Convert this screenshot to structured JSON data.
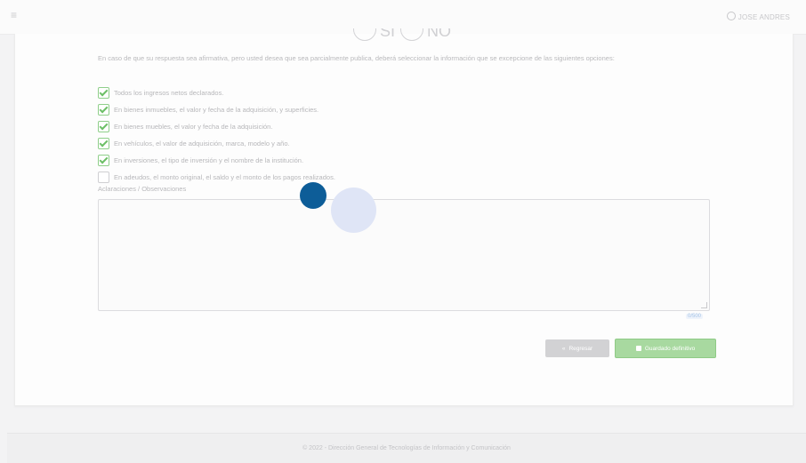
{
  "topbar": {
    "menu_icon": "hamburger-menu-icon",
    "user_icon": "user-circle-icon",
    "user_name": "JOSE ANDRES"
  },
  "question": {
    "yes_label": "SI",
    "no_label": "NO"
  },
  "intro_text": "En caso de que su respuesta sea afirmativa, pero usted desea que sea parcialmente publica, deberá seleccionar la información que se excepcione de las siguientes opciones:",
  "options": [
    {
      "label": "Todos los ingresos netos declarados.",
      "checked": true
    },
    {
      "label": "En bienes inmuebles, el valor y fecha de la adquisición, y superficies.",
      "checked": true
    },
    {
      "label": "En bienes muebles, el valor y fecha de la adquisición.",
      "checked": true
    },
    {
      "label": "En vehículos, el valor de adquisición, marca, modelo y año.",
      "checked": true
    },
    {
      "label": "En inversiones, el tipo de inversión y el nombre de la institución.",
      "checked": true
    },
    {
      "label": "En adeudos, el monto original, el saldo y el monto de los pagos realizados.",
      "checked": false
    }
  ],
  "observations": {
    "label": "Aclaraciones / Observaciones",
    "value": "",
    "counter": "0/500"
  },
  "buttons": {
    "back_label": "Regresar",
    "back_icon": "double-chevron-left-icon",
    "save_label": "Guardado definitivo",
    "save_icon": "floppy-disk-icon"
  },
  "footer": {
    "text": "© 2022 - Dirección General de Tecnologías de Información y Comunicación"
  },
  "colors": {
    "check": "#6cbf66",
    "save_button": "#a8d9a0",
    "blue_dot": "#0d5d98"
  }
}
